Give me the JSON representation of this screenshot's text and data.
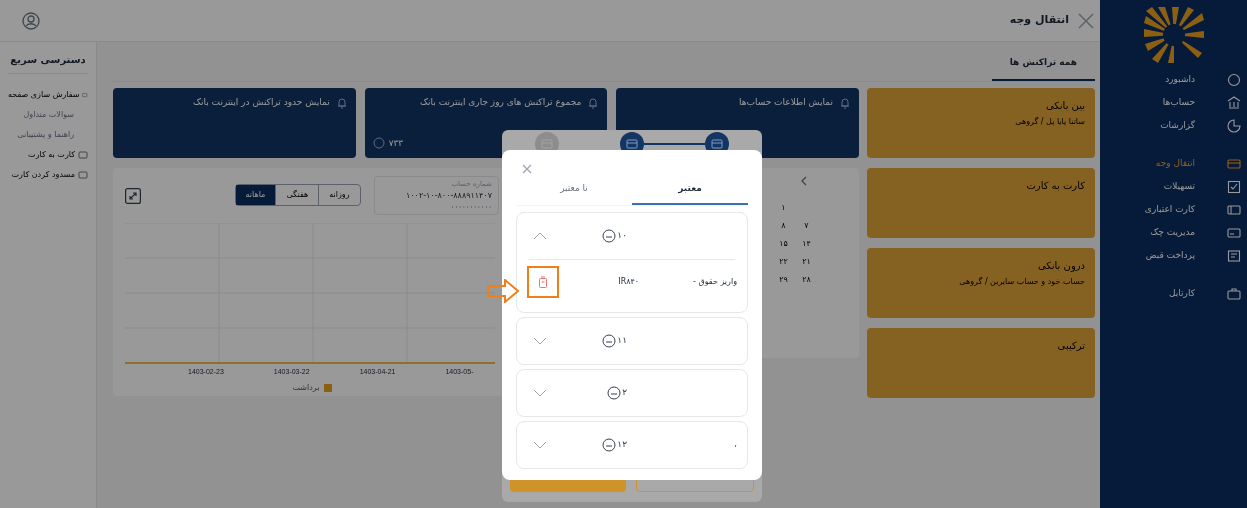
{
  "header": {
    "title": "انتقال وجه"
  },
  "sidebar": {
    "groups": [
      {
        "items": [
          {
            "label": "داشبورد",
            "selected": false
          },
          {
            "label": "حساب‌ها",
            "selected": false
          },
          {
            "label": "گزارشات",
            "selected": false
          }
        ]
      },
      {
        "items": [
          {
            "label": "انتقال وجه",
            "selected": true
          },
          {
            "label": "تسهیلات",
            "selected": false
          },
          {
            "label": "کارت اعتباری",
            "selected": false
          },
          {
            "label": "مدیریت چک",
            "selected": false
          },
          {
            "label": "پرداخت قبض",
            "selected": false
          }
        ]
      },
      {
        "items": [
          {
            "label": "کارتابل",
            "selected": false
          }
        ]
      }
    ]
  },
  "quick_access": {
    "title": "دسترسی سریع",
    "items": [
      {
        "label": "سفارش سازی صفحه",
        "disabled": false
      },
      {
        "label": "سوالات متداول",
        "disabled": true
      },
      {
        "label": "راهنما و پشتیبانی",
        "disabled": true
      },
      {
        "label": "کارت به کارت",
        "disabled": false
      },
      {
        "label": "مسدود کردن کارت",
        "disabled": false
      }
    ]
  },
  "page_tabs": [
    {
      "label": "همه تراکنش ها",
      "selected": true
    }
  ],
  "service_cards": [
    {
      "title": "بین بانکی",
      "subtitle": "ساتنا پایا پل / گروهی"
    },
    {
      "title": "کارت به کارت"
    },
    {
      "title": "درون بانکی",
      "subtitle": "حساب خود و حساب سایرین / گروهی"
    },
    {
      "title": "ترکیبی"
    }
  ],
  "widgets": [
    {
      "title": "نمایش اطلاعات حساب‌ها"
    },
    {
      "title": "مجموع تراکنش های روز جاری اینترنت بانک",
      "value": "۷۳۳"
    },
    {
      "title": "نمایش حدود تراکنش در اینترنت بانک"
    }
  ],
  "calendar": {
    "rows": [
      [
        "",
        "۱"
      ],
      [
        "۷",
        "۸"
      ],
      [
        "۱۴",
        "۱۵"
      ],
      [
        "۲۱",
        "۲۲"
      ],
      [
        "۲۸",
        "۲۹"
      ]
    ]
  },
  "account_select": {
    "label": "شماره حساب",
    "value": "۱۰۰۲-۱۰-۸۰۰-۸۸۸۹۱۱۴۰۷",
    "secondary": "۰۰۰۰۰۰۰۰۰۰۰"
  },
  "period_tabs": [
    {
      "label": "روزانه",
      "selected": false
    },
    {
      "label": "هفتگی",
      "selected": false
    },
    {
      "label": "ماهانه",
      "selected": true
    }
  ],
  "chart": {
    "x_labels": [
      "1403-05-",
      "1403-04-21",
      "1403-03-22",
      "1403-02-23"
    ],
    "legend": "برداشت"
  },
  "stepper": {
    "steps": [
      {
        "active": true
      },
      {
        "active": true
      },
      {
        "active": false
      }
    ]
  },
  "modal": {
    "tabs": [
      {
        "label": "معتبر",
        "selected": true
      },
      {
        "label": "نا معتبر",
        "selected": false
      }
    ],
    "groups": [
      {
        "number": "۱۰",
        "expanded": true,
        "rows": [
          {
            "description": "واریز حقوق -",
            "iban": "IR۸۴۰",
            "highlighted": true
          }
        ]
      },
      {
        "number": "۱۱",
        "expanded": false
      },
      {
        "number": "۲",
        "expanded": false
      },
      {
        "number": "۱۲",
        "expanded": false,
        "note": "،"
      }
    ]
  }
}
